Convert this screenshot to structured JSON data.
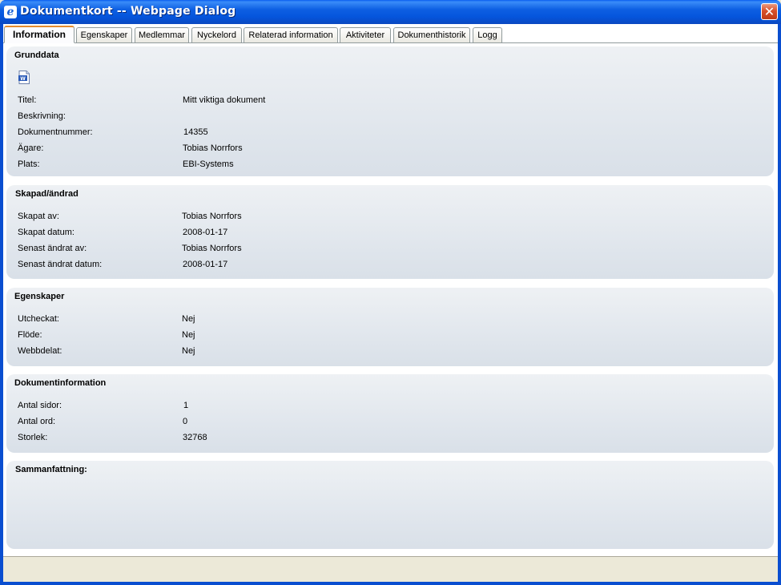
{
  "window": {
    "title": "Dokumentkort -- Webpage Dialog",
    "close_glyph": "✕"
  },
  "tabs": [
    {
      "label": "Information",
      "active": true
    },
    {
      "label": "Egenskaper",
      "active": false
    },
    {
      "label": "Medlemmar",
      "active": false
    },
    {
      "label": "Nyckelord",
      "active": false
    },
    {
      "label": "Relaterad information",
      "active": false
    },
    {
      "label": "Aktiviteter",
      "active": false
    },
    {
      "label": "Dokumenthistorik",
      "active": false
    },
    {
      "label": "Logg",
      "active": false
    }
  ],
  "sections": {
    "grunddata": {
      "title": "Grunddata",
      "icon": "word-document-icon",
      "rows": [
        {
          "label": "Titel:",
          "value": "Mitt viktiga dokument"
        },
        {
          "label": "Beskrivning:",
          "value": ""
        },
        {
          "label": "Dokumentnummer:",
          "value": "14355"
        },
        {
          "label": "Ägare:",
          "value": "Tobias Norrfors"
        },
        {
          "label": "Plats:",
          "value": "EBI-Systems"
        }
      ]
    },
    "skapad": {
      "title": "Skapad/ändrad",
      "rows": [
        {
          "label": "Skapat av:",
          "value": "Tobias Norrfors"
        },
        {
          "label": "Skapat datum:",
          "value": "2008-01-17"
        },
        {
          "label": "Senast ändrat av:",
          "value": "Tobias Norrfors"
        },
        {
          "label": "Senast ändrat datum:",
          "value": "2008-01-17"
        }
      ]
    },
    "egenskaper": {
      "title": "Egenskaper",
      "rows": [
        {
          "label": "Utcheckat:",
          "value": "Nej"
        },
        {
          "label": "Flöde:",
          "value": "Nej"
        },
        {
          "label": "Webbdelat:",
          "value": "Nej"
        }
      ]
    },
    "dokumentinfo": {
      "title": "Dokumentinformation",
      "rows": [
        {
          "label": "Antal sidor:",
          "value": "1"
        },
        {
          "label": "Antal ord:",
          "value": "0"
        },
        {
          "label": "Storlek:",
          "value": "32768"
        }
      ]
    },
    "sammanfattning": {
      "title": "Sammanfattning:"
    }
  },
  "colors": {
    "titlebar": "#0a5ef0",
    "active_tab_accent": "#e68b2c",
    "panel": "#dfe5ec"
  }
}
